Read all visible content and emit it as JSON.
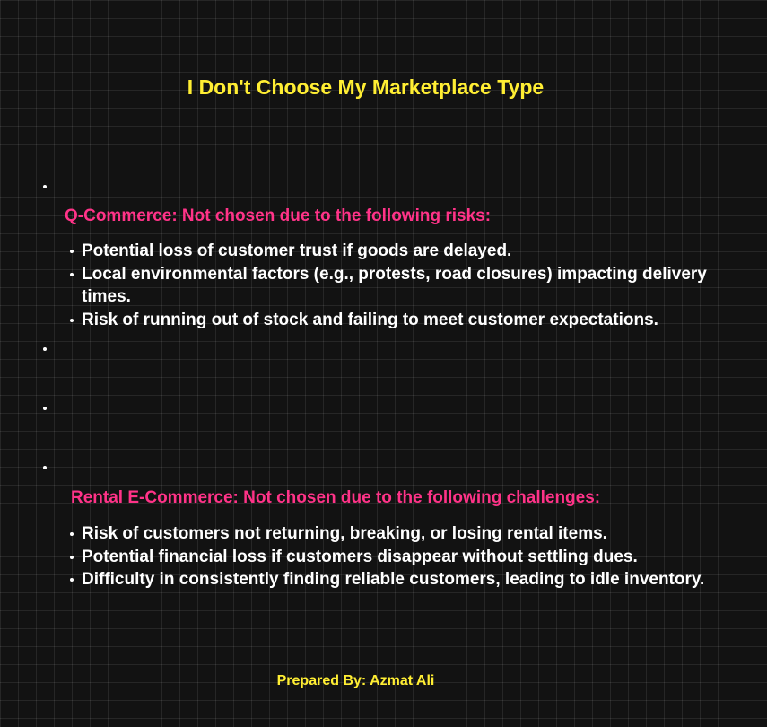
{
  "title": "I Don't Choose My Marketplace Type",
  "sections": [
    {
      "heading": "Q-Commerce: Not chosen due to the following risks:",
      "points": [
        "Potential loss of customer trust if goods are delayed.",
        "Local environmental factors (e.g., protests, road closures) impacting delivery times.",
        "Risk of running out of stock and failing to meet customer expectations."
      ]
    },
    {
      "heading": "Rental E-Commerce: Not chosen due to the following challenges:",
      "points": [
        "Risk of customers not returning, breaking, or losing rental items.",
        "Potential financial loss if customers disappear without settling dues.",
        "Difficulty in consistently finding reliable customers, leading to idle inventory."
      ]
    }
  ],
  "footer": "Prepared By: Azmat Ali",
  "colors": {
    "background": "#121212",
    "title": "#ffee33",
    "heading": "#ff3388",
    "body_text": "#ffffff",
    "footer": "#ffee33"
  }
}
